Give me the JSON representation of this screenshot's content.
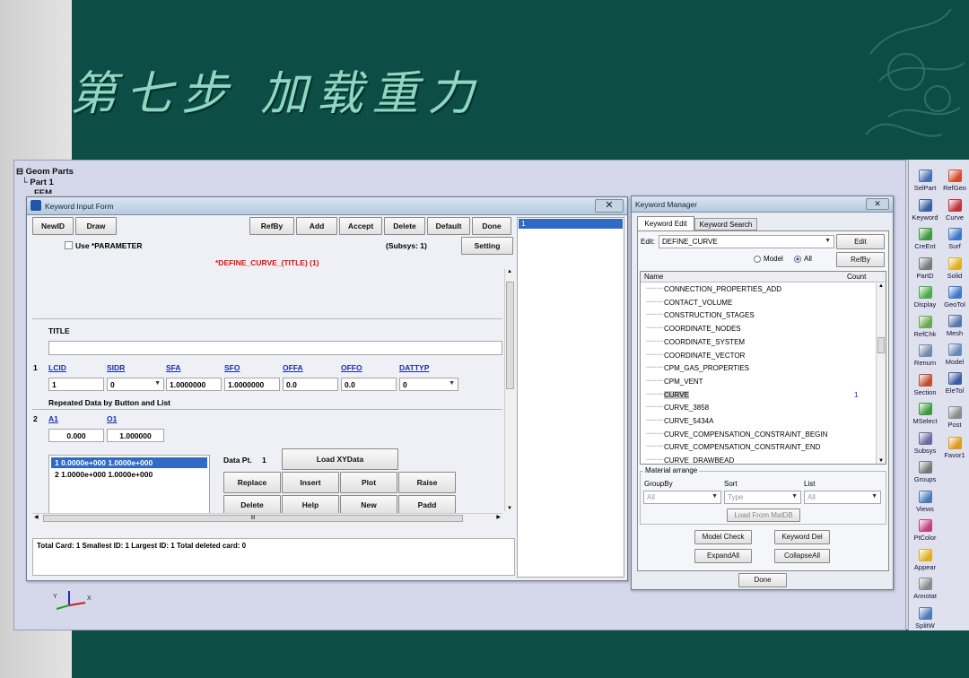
{
  "slide": {
    "title": "第七步 加载重力"
  },
  "tree": {
    "items": [
      "Geom Parts",
      "Part 1",
      "FEM"
    ]
  },
  "keyword_form": {
    "window_title": "Keyword Input Form",
    "buttons_left": [
      "NewID",
      "Draw"
    ],
    "buttons_right": [
      "RefBy",
      "Add",
      "Accept",
      "Delete",
      "Default",
      "Done"
    ],
    "use_parameter_label": "Use *PARAMETER",
    "subsys": "(Subsys: 1)",
    "setting_label": "Setting",
    "keyword_header": "*DEFINE_CURVE_(TITLE)  (1)",
    "title_label": "TITLE",
    "card1": {
      "number": "1",
      "fields": [
        "LCID",
        "SIDR",
        "SFA",
        "SFO",
        "OFFA",
        "OFFO",
        "DATTYP"
      ],
      "values": [
        "1",
        "0",
        "1.0000000",
        "1.0000000",
        "0.0",
        "0.0",
        "0"
      ]
    },
    "repeated_label": "Repeated Data by Button and List",
    "card2": {
      "number": "2",
      "fields": [
        "A1",
        "O1"
      ],
      "values": [
        "0.000",
        "1.000000"
      ]
    },
    "data_list": [
      "1  0.0000e+000 1.0000e+000",
      "2  1.0000e+000 1.0000e+000"
    ],
    "data_pt_label": "Data Pt.",
    "data_pt_value": "1",
    "load_xydata": "Load XYData",
    "grid_buttons": [
      "Replace",
      "Insert",
      "Plot",
      "Raise",
      "Delete",
      "Help",
      "New",
      "Padd"
    ],
    "scroll_mid": "III",
    "status": "Total Card: 1    Smallest ID: 1    Largest ID: 1    Total deleted card:  0",
    "list_value": "1"
  },
  "keyword_manager": {
    "window_title": "Keyword Manager",
    "tabs": [
      "Keyword Edit",
      "Keyword Search"
    ],
    "edit_label": "Edit:",
    "edit_value": "DEFINE_CURVE",
    "edit_button": "Edit",
    "radio_model": "Model",
    "radio_all": "All",
    "refby_button": "RefBy",
    "col_name": "Name",
    "col_count": "Count",
    "items": [
      {
        "name": "CONNECTION_PROPERTIES_ADD",
        "count": ""
      },
      {
        "name": "CONTACT_VOLUME",
        "count": ""
      },
      {
        "name": "CONSTRUCTION_STAGES",
        "count": ""
      },
      {
        "name": "COORDINATE_NODES",
        "count": ""
      },
      {
        "name": "COORDINATE_SYSTEM",
        "count": ""
      },
      {
        "name": "COORDINATE_VECTOR",
        "count": ""
      },
      {
        "name": "CPM_GAS_PROPERTIES",
        "count": ""
      },
      {
        "name": "CPM_VENT",
        "count": ""
      },
      {
        "name": "CURVE",
        "count": "1"
      },
      {
        "name": "CURVE_3858",
        "count": ""
      },
      {
        "name": "CURVE_5434A",
        "count": ""
      },
      {
        "name": "CURVE_COMPENSATION_CONSTRAINT_BEGIN",
        "count": ""
      },
      {
        "name": "CURVE_COMPENSATION_CONSTRAINT_END",
        "count": ""
      },
      {
        "name": "CURVE_DRAWBEAD",
        "count": ""
      }
    ],
    "material_arrange": "Material arrange",
    "groupby_label": "GroupBy",
    "sort_label": "Sort",
    "list_label": "List",
    "groupby_value": "All",
    "sort_value": "Type",
    "list_select_value": "All",
    "load_matdb": "Load From MatDB",
    "model_check": "Model Check",
    "keyword_del": "Keyword Del",
    "expand_all": "ExpandAll",
    "collapse_all": "CollapseAll",
    "done": "Done"
  },
  "toolbar": {
    "items": [
      {
        "label": "SelPart",
        "icon": "select-part-icon",
        "color": "#4a6fb0"
      },
      {
        "label": "RefGeo",
        "icon": "ref-geometry-icon",
        "color": "#d04b2c"
      },
      {
        "label": "Keyword",
        "icon": "keyword-icon",
        "color": "#3a5ea0"
      },
      {
        "label": "Curve",
        "icon": "curve-icon",
        "color": "#c0303a"
      },
      {
        "label": "CreEnt",
        "icon": "create-entity-icon",
        "color": "#3d9a3d"
      },
      {
        "label": "Surf",
        "icon": "surface-icon",
        "color": "#3d78c8"
      },
      {
        "label": "PartD",
        "icon": "part-data-icon",
        "color": "#7a7a7a"
      },
      {
        "label": "Solid",
        "icon": "solid-icon",
        "color": "#e0b020"
      },
      {
        "label": "Display",
        "icon": "display-icon",
        "color": "#4caa4c"
      },
      {
        "label": "GeoTol",
        "icon": "geo-tolerance-icon",
        "color": "#3d78c8"
      },
      {
        "label": "RefChk",
        "icon": "reference-check-icon",
        "color": "#6aa84f"
      },
      {
        "label": "Mesh",
        "icon": "mesh-icon",
        "color": "#5577aa"
      },
      {
        "label": "Renum",
        "icon": "renumber-icon",
        "color": "#7788aa"
      },
      {
        "label": "Model",
        "icon": "model-icon",
        "color": "#6688bb"
      },
      {
        "label": "Section",
        "icon": "section-icon",
        "color": "#c05030"
      },
      {
        "label": "EleTol",
        "icon": "element-tolerance-icon",
        "color": "#3a5ea0"
      },
      {
        "label": "MSelect",
        "icon": "multi-select-icon",
        "color": "#3d9a3d"
      },
      {
        "label": "Post",
        "icon": "post-icon",
        "color": "#8a8a8a"
      },
      {
        "label": "Subsys",
        "icon": "subsystem-icon",
        "color": "#6a6aa0"
      },
      {
        "label": "Favor1",
        "icon": "favorite-icon",
        "color": "#dd9922"
      },
      {
        "label": "Groups",
        "icon": "groups-icon",
        "color": "#777777"
      },
      {
        "label": "Views",
        "icon": "views-icon",
        "color": "#4a7ab8"
      },
      {
        "label": "PtColor",
        "icon": "part-color-icon",
        "color": "#c04080"
      },
      {
        "label": "Appear",
        "icon": "appearance-icon",
        "color": "#e0b020"
      },
      {
        "label": "Annotat",
        "icon": "annotation-icon",
        "color": "#8a8a8a"
      },
      {
        "label": "SplitW",
        "icon": "split-window-icon",
        "color": "#4a7ab8"
      }
    ]
  }
}
